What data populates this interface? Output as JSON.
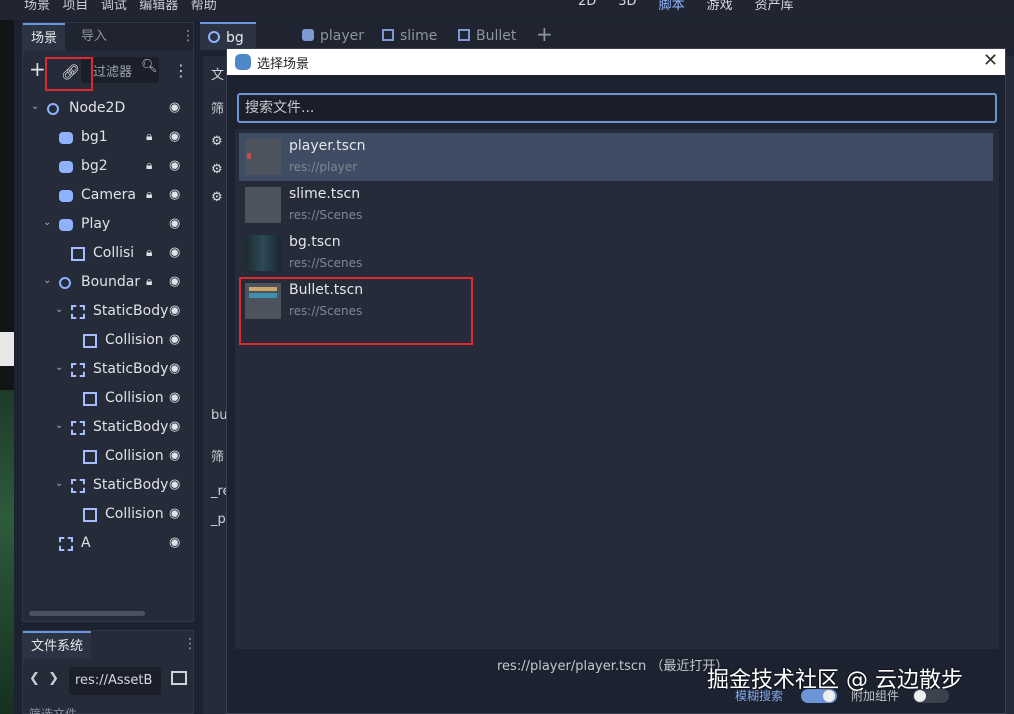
{
  "menubar": {
    "items": [
      "场景",
      "项目",
      "调试",
      "编辑器",
      "帮助"
    ],
    "modes": [
      "2D",
      "3D",
      "脚本",
      "游戏",
      "资产库"
    ],
    "active_mode": "脚本"
  },
  "scene_dock": {
    "tabs": [
      {
        "label": "场景",
        "active": true
      },
      {
        "label": "导入",
        "active": false
      }
    ],
    "filter_placeholder": "过滤器",
    "tree": [
      {
        "label": "Node2D",
        "icon": "node2d-circle-icon",
        "depth": 0
      },
      {
        "label": "bg1",
        "icon": "sprite-icon",
        "depth": 1,
        "locked": true
      },
      {
        "label": "bg2",
        "icon": "sprite-icon",
        "depth": 1,
        "locked": true
      },
      {
        "label": "Camera",
        "icon": "camera-icon",
        "depth": 1,
        "locked": true
      },
      {
        "label": "Play",
        "icon": "character-icon",
        "depth": 1,
        "expanded": true
      },
      {
        "label": "Collisi",
        "icon": "collision-square-icon",
        "depth": 2,
        "locked": true
      },
      {
        "label": "Boundar",
        "icon": "node2d-circle-icon",
        "depth": 1,
        "expanded": true,
        "locked": true
      },
      {
        "label": "StaticBody",
        "icon": "staticbody-icon",
        "depth": 2,
        "expanded": true
      },
      {
        "label": "Collision",
        "icon": "collision-square-icon",
        "depth": 3
      },
      {
        "label": "StaticBody",
        "icon": "staticbody-icon",
        "depth": 2,
        "expanded": true
      },
      {
        "label": "Collision",
        "icon": "collision-square-icon",
        "depth": 3
      },
      {
        "label": "StaticBody",
        "icon": "staticbody-icon",
        "depth": 2,
        "expanded": true
      },
      {
        "label": "Collision",
        "icon": "collision-square-icon",
        "depth": 3
      },
      {
        "label": "StaticBody",
        "icon": "staticbody-icon",
        "depth": 2,
        "expanded": true
      },
      {
        "label": "Collision",
        "icon": "collision-square-icon",
        "depth": 3
      },
      {
        "label": "A",
        "icon": "area-icon",
        "depth": 1
      }
    ]
  },
  "file_dock": {
    "tab": "文件系统",
    "path": "res://AssetB",
    "filter_placeholder": "筛选文件"
  },
  "editor_tabs": [
    {
      "label": "bg",
      "active": true
    },
    {
      "label": "player",
      "active": false
    },
    {
      "label": "slime",
      "active": false
    },
    {
      "label": "Bullet",
      "active": false
    }
  ],
  "inspector_fragments": [
    "文",
    "筛",
    "bu",
    "筛",
    "_re",
    "_p"
  ],
  "dialog": {
    "title": "选择场景",
    "search_placeholder": "搜索文件...",
    "results": [
      {
        "name": "player.tscn",
        "path": "res://player",
        "selected": true
      },
      {
        "name": "slime.tscn",
        "path": "res://Scenes",
        "selected": false
      },
      {
        "name": "bg.tscn",
        "path": "res://Scenes",
        "selected": false
      },
      {
        "name": "Bullet.tscn",
        "path": "res://Scenes",
        "selected": false
      }
    ],
    "recent_text": "res://player/player.tscn （最近打开）",
    "fuzzy_label": "模糊搜索",
    "fuzzy_on": true,
    "add_component_label": "附加组件",
    "add_component_on": false
  },
  "watermark": "掘金技术社区 @ 云边散步",
  "colors": {
    "accent": "#6d94d6",
    "highlight_box": "#e0282e",
    "selected_row": "#3e4d64"
  }
}
